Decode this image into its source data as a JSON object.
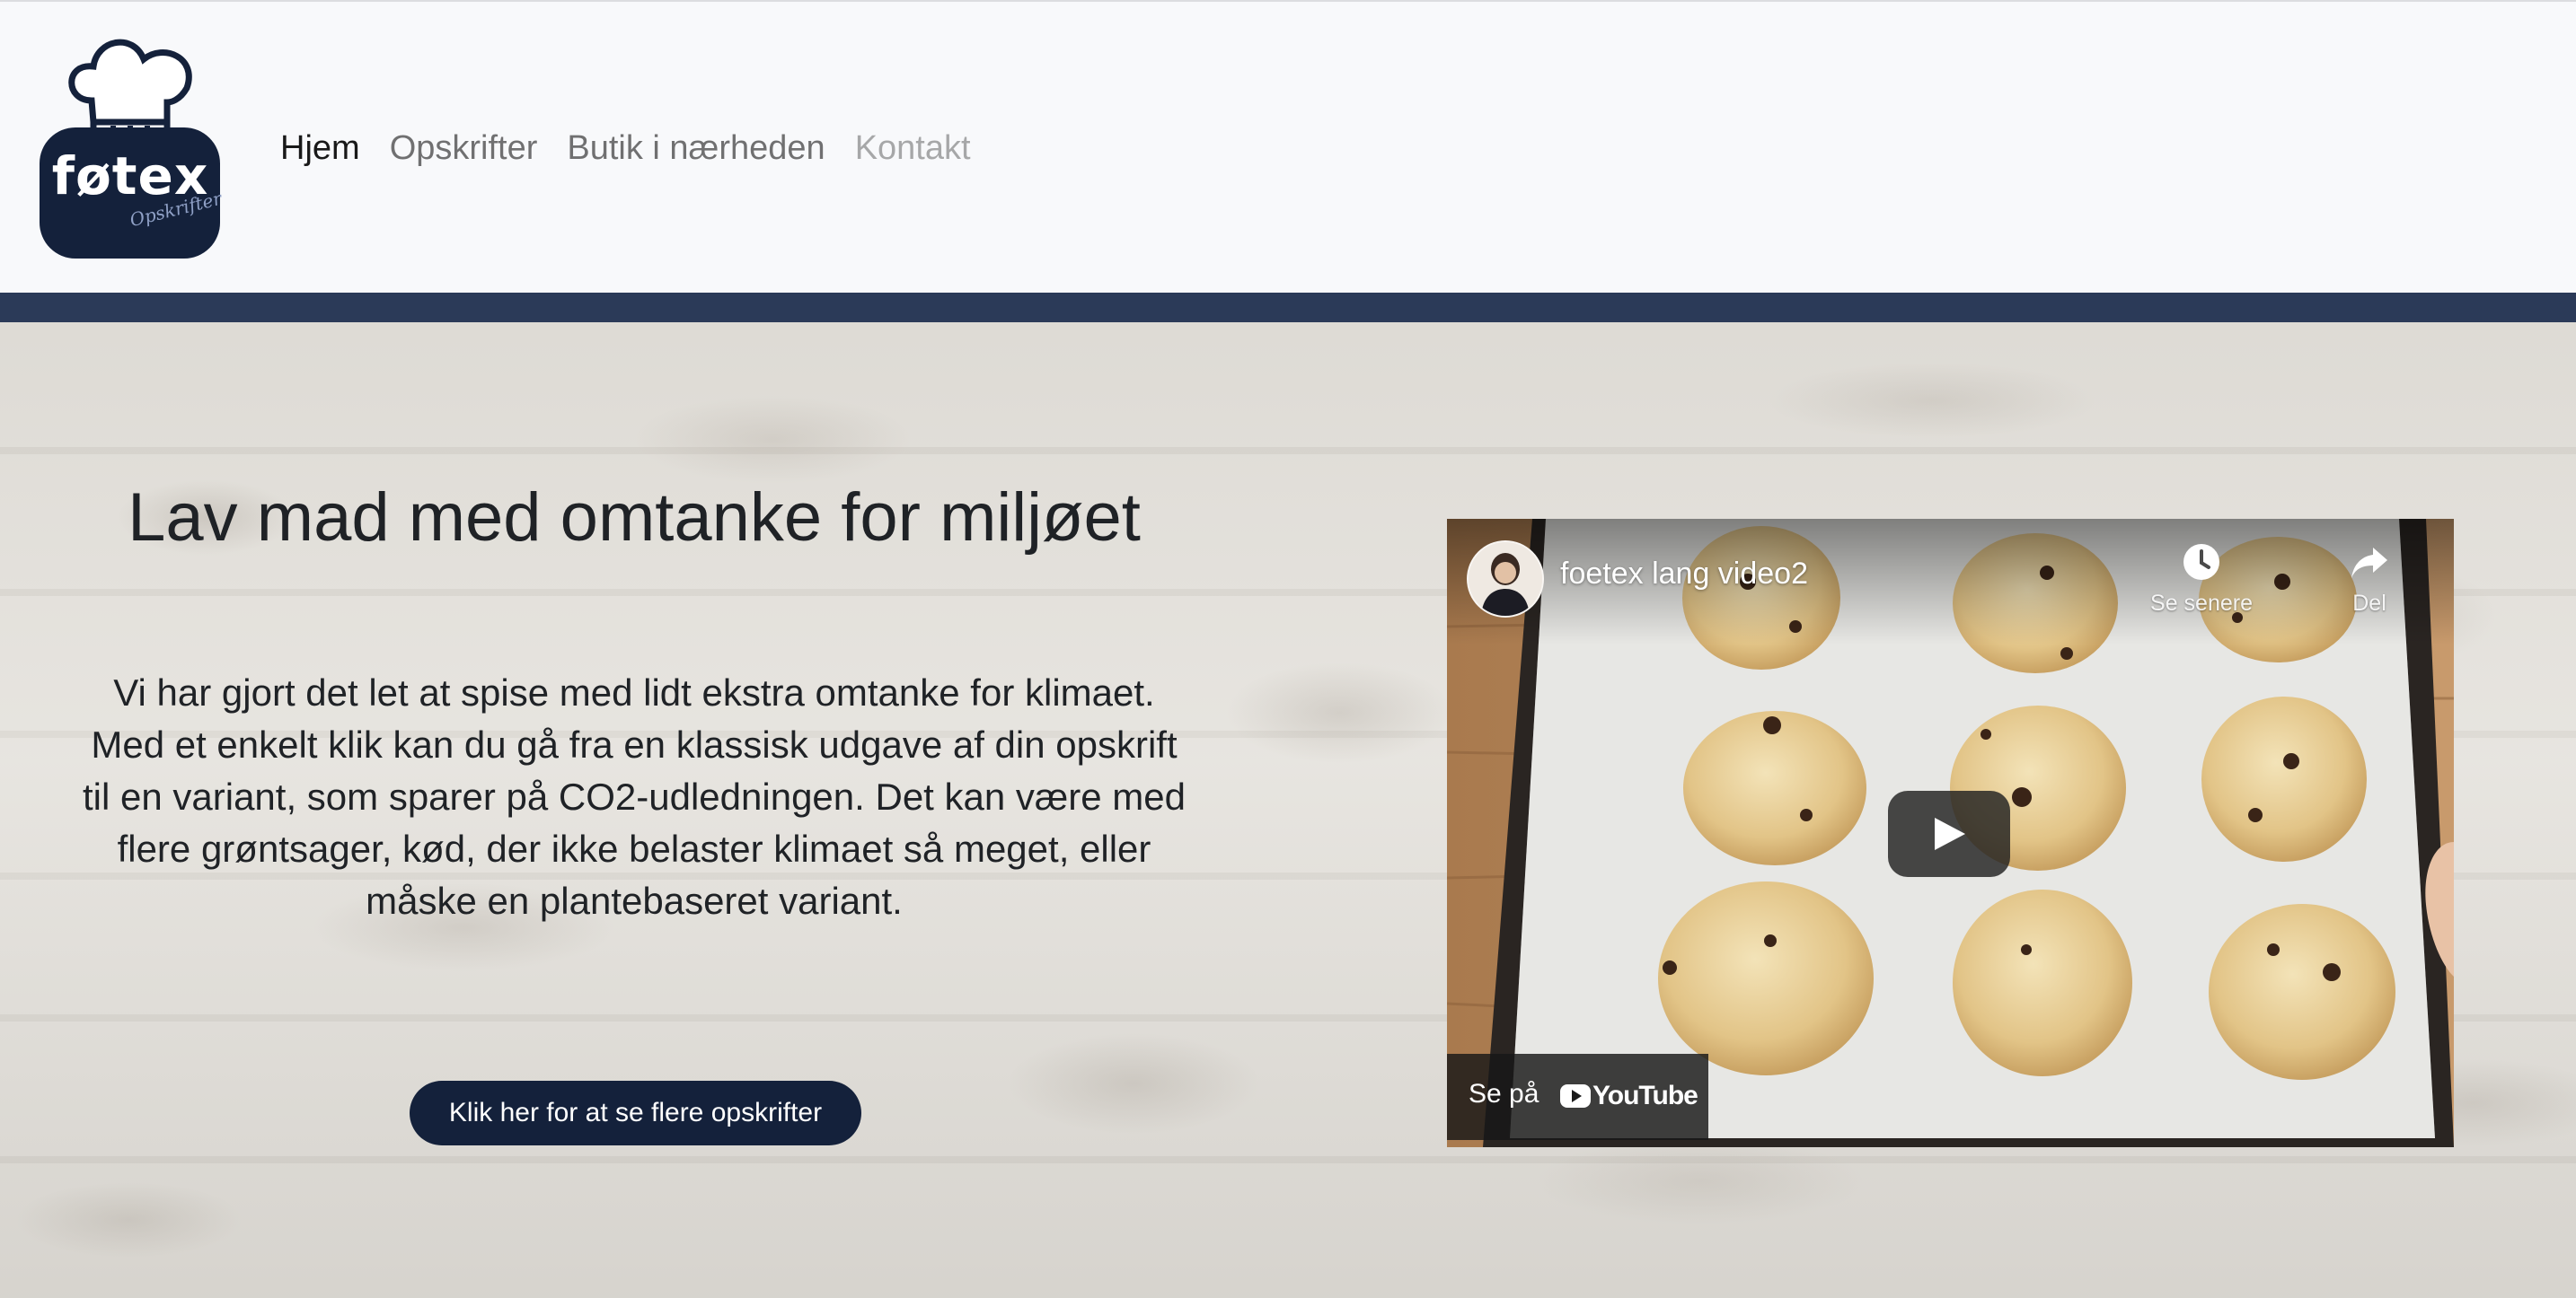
{
  "logo": {
    "brand": "føtex",
    "tagline": "Opskrifter",
    "icon": "chef-hat-icon"
  },
  "nav": {
    "items": [
      {
        "label": "Hjem",
        "state": "active"
      },
      {
        "label": "Opskrifter",
        "state": "normal"
      },
      {
        "label": "Butik i nærheden",
        "state": "normal"
      },
      {
        "label": "Kontakt",
        "state": "muted"
      }
    ]
  },
  "hero": {
    "title": "Lav mad med omtanke for miljøet",
    "text": "Vi har gjort det let at spise med lidt ekstra omtanke for klimaet. Med et enkelt klik kan du gå fra en klassisk udgave af din opskrift til en variant, som sparer på CO2-udledningen. Det kan være med flere grøntsager, kød, der ikke belaster klimaet så meget, eller måske en plantebaseret variant.",
    "button_label": "Klik her for at se flere opskrifter"
  },
  "video": {
    "title": "foetex lang video2",
    "watch_later_label": "Se senere",
    "share_label": "Del",
    "watch_on_label": "Se på",
    "platform_label": "YouTube",
    "icons": {
      "watch_later": "clock-icon",
      "share": "share-icon",
      "play": "play-icon",
      "platform": "youtube-icon"
    }
  },
  "colors": {
    "navbar_bg": "#f8f9fb",
    "accent_band": "#2b3a58",
    "button_bg": "#14213b",
    "logo_bg": "#14213b",
    "text": "#1f2226"
  }
}
